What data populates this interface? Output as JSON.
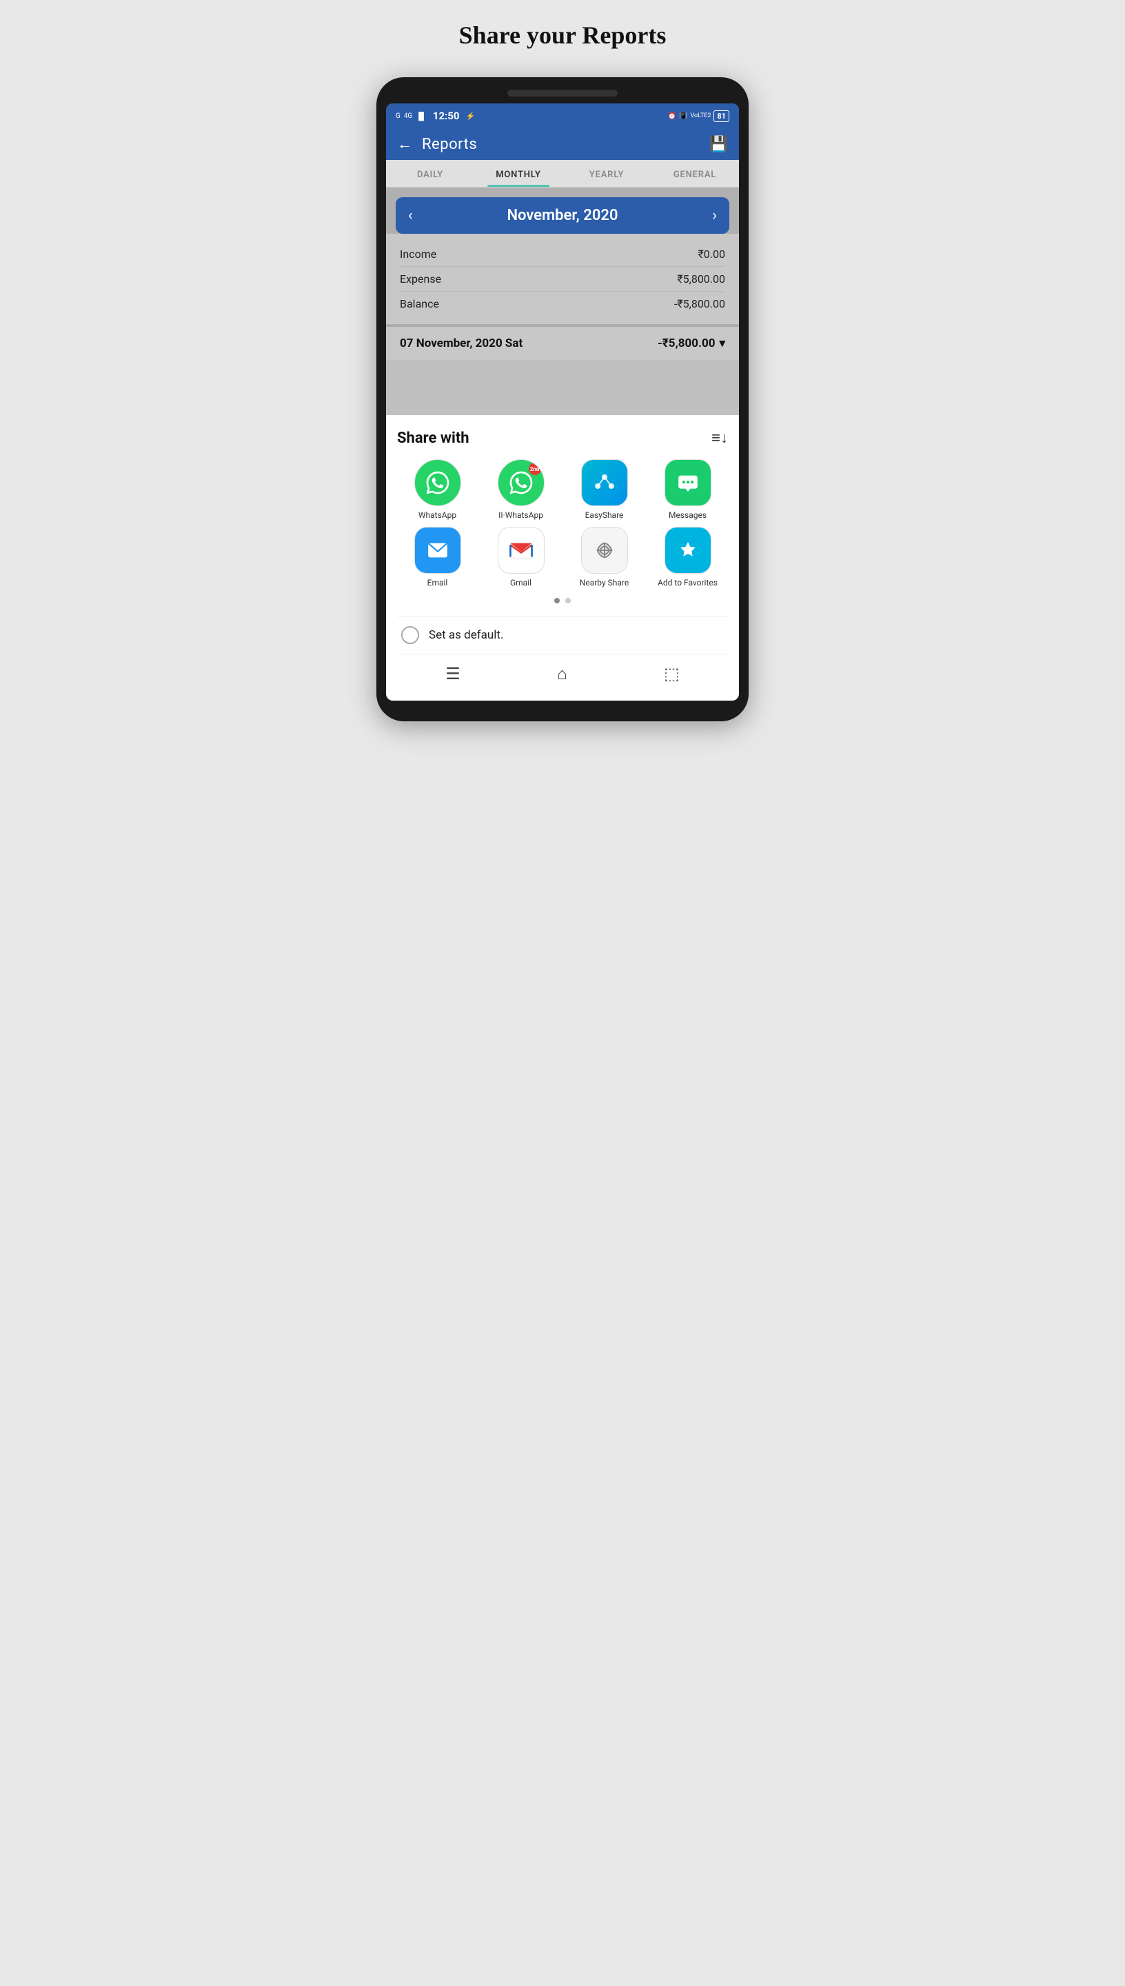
{
  "page": {
    "title": "Share your Reports"
  },
  "statusBar": {
    "time": "12:50",
    "leftIcons": [
      "G",
      "4G",
      "signal",
      "USB"
    ],
    "rightIcons": [
      "alarm",
      "vibrate",
      "VoLTE",
      "battery"
    ],
    "batteryPercent": "81"
  },
  "appBar": {
    "title": "Reports",
    "backLabel": "←",
    "saveLabel": "💾"
  },
  "tabs": [
    {
      "label": "DAILY",
      "active": false
    },
    {
      "label": "MONTHLY",
      "active": true
    },
    {
      "label": "YEARLY",
      "active": false
    },
    {
      "label": "GENERAL",
      "active": false
    }
  ],
  "monthNav": {
    "label": "November, 2020",
    "prevArrow": "‹",
    "nextArrow": "›"
  },
  "summary": {
    "income": {
      "label": "Income",
      "value": "₹0.00"
    },
    "expense": {
      "label": "Expense",
      "value": "₹5,800.00"
    },
    "balance": {
      "label": "Balance",
      "value": "-₹5,800.00"
    }
  },
  "dateRow": {
    "label": "07 November, 2020 Sat",
    "value": "-₹5,800.00",
    "chevron": "▾"
  },
  "shareSheet": {
    "title": "Share with",
    "sortIcon": "≡↓",
    "apps": [
      {
        "name": "WhatsApp",
        "iconType": "whatsapp",
        "badge": ""
      },
      {
        "name": "II·WhatsApp",
        "iconType": "whatsapp2",
        "badge": "2nd"
      },
      {
        "name": "EasyShare",
        "iconType": "easyshare",
        "badge": ""
      },
      {
        "name": "Messages",
        "iconType": "messages",
        "badge": ""
      },
      {
        "name": "Email",
        "iconType": "email",
        "badge": ""
      },
      {
        "name": "Gmail",
        "iconType": "gmail",
        "badge": ""
      },
      {
        "name": "Nearby Share",
        "iconType": "nearby",
        "badge": ""
      },
      {
        "name": "Add to Favorites",
        "iconType": "favorites",
        "badge": ""
      }
    ],
    "dots": [
      true,
      false
    ],
    "defaultLabel": "Set as default."
  },
  "bottomNav": {
    "menuIcon": "☰",
    "homeIcon": "⌂",
    "backIcon": "⬚"
  }
}
